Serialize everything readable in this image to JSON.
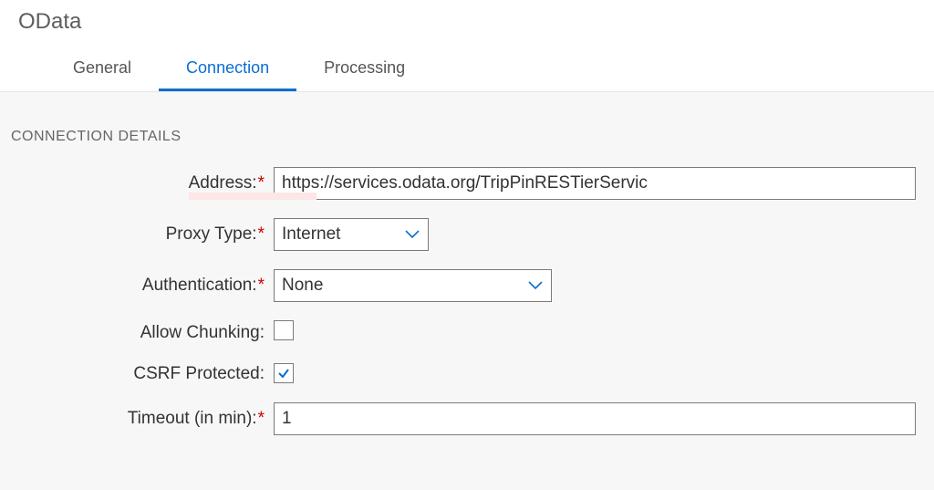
{
  "title": "OData",
  "tabs": [
    {
      "label": "General",
      "selected": false
    },
    {
      "label": "Connection",
      "selected": true
    },
    {
      "label": "Processing",
      "selected": false
    }
  ],
  "section_title": "CONNECTION DETAILS",
  "fields": {
    "address": {
      "label": "Address:",
      "required": true,
      "value": "https://services.odata.org/TripPinRESTierServic"
    },
    "proxy_type": {
      "label": "Proxy Type:",
      "required": true,
      "value": "Internet"
    },
    "authentication": {
      "label": "Authentication:",
      "required": true,
      "value": "None"
    },
    "allow_chunking": {
      "label": "Allow Chunking:",
      "required": false,
      "checked": false
    },
    "csrf_protected": {
      "label": "CSRF Protected:",
      "required": false,
      "checked": true
    },
    "timeout": {
      "label": "Timeout (in min):",
      "required": true,
      "value": "1"
    }
  },
  "colors": {
    "accent": "#0a6ed1",
    "required": "#c00"
  }
}
